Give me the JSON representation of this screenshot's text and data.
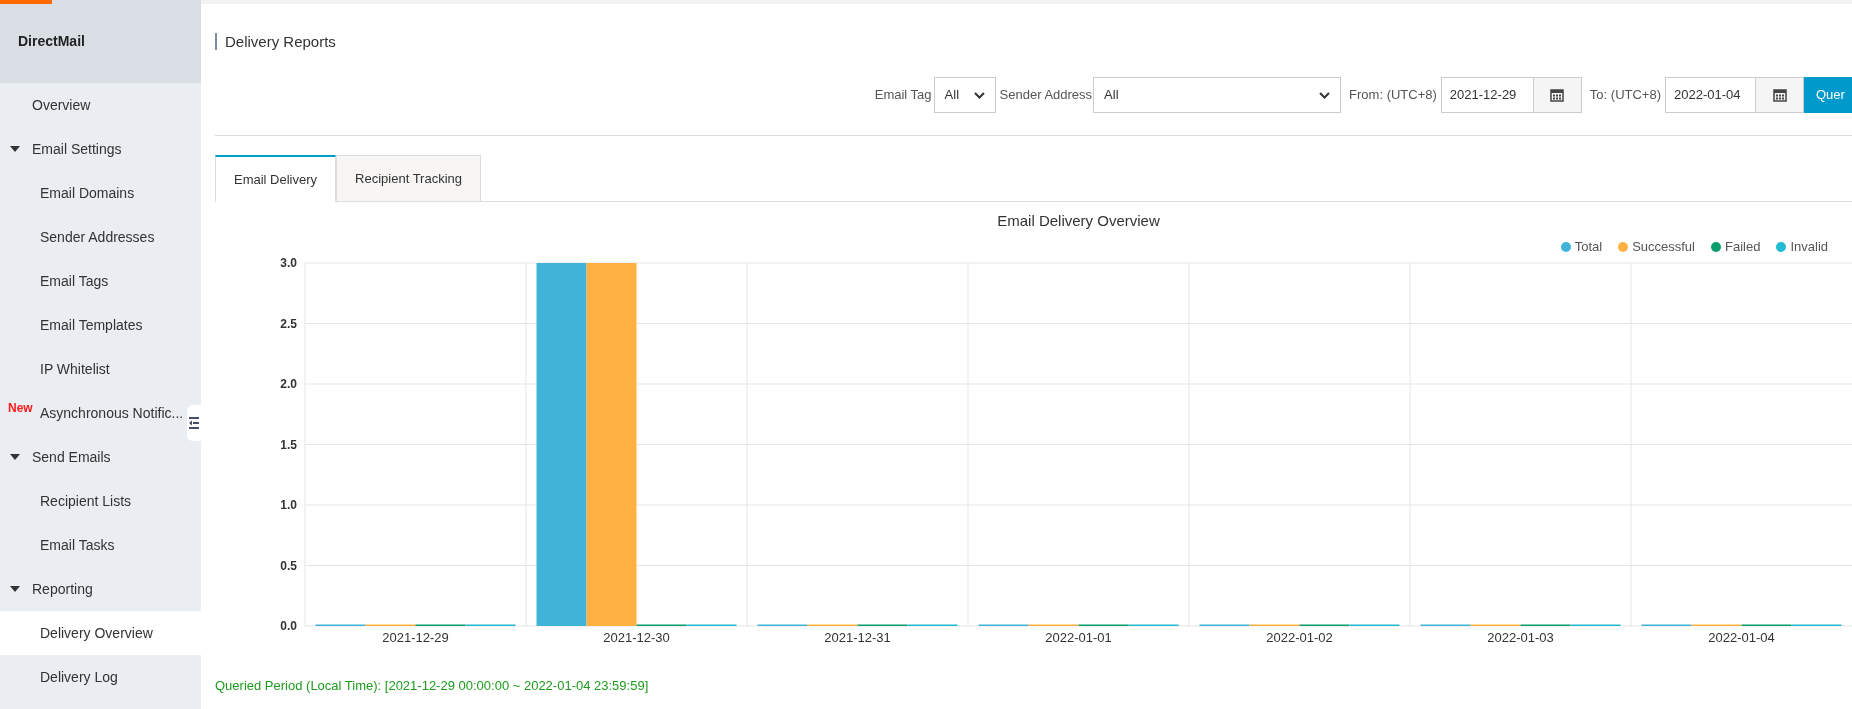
{
  "sidebar": {
    "title": "DirectMail",
    "items": [
      {
        "label": "Overview",
        "selected": false
      },
      {
        "label": "Email Settings",
        "expanded": true,
        "children": [
          {
            "label": "Email Domains",
            "selected": false
          },
          {
            "label": "Sender Addresses",
            "selected": false
          },
          {
            "label": "Email Tags",
            "selected": false
          },
          {
            "label": "Email Templates",
            "selected": false
          },
          {
            "label": "IP Whitelist",
            "selected": false
          },
          {
            "label": "Asynchronous Notific...",
            "badge": "New",
            "selected": false
          }
        ]
      },
      {
        "label": "Send Emails",
        "expanded": true,
        "children": [
          {
            "label": "Recipient Lists",
            "selected": false
          },
          {
            "label": "Email Tasks",
            "selected": false
          }
        ]
      },
      {
        "label": "Reporting",
        "expanded": true,
        "children": [
          {
            "label": "Delivery Overview",
            "selected": true
          },
          {
            "label": "Delivery Log",
            "selected": false
          }
        ]
      }
    ]
  },
  "page_title": "Delivery Reports",
  "filters": {
    "email_tag": {
      "label": "Email Tag",
      "value": "All"
    },
    "sender_address": {
      "label": "Sender Address",
      "value": "All"
    },
    "from": {
      "label": "From: (UTC+8)",
      "value": "2021-12-29"
    },
    "to": {
      "label": "To: (UTC+8)",
      "value": "2022-01-04"
    },
    "query_button": "Quer"
  },
  "tabs": [
    {
      "label": "Email Delivery",
      "selected": true
    },
    {
      "label": "Recipient Tracking",
      "selected": false
    }
  ],
  "chart": {
    "chart_data": {
      "type": "bar",
      "title": "Email Delivery Overview",
      "categories": [
        "2021-12-29",
        "2021-12-30",
        "2021-12-31",
        "2022-01-01",
        "2022-01-02",
        "2022-01-03",
        "2022-01-04"
      ],
      "series": [
        {
          "name": "Total",
          "color": "#41b3d9",
          "values": [
            0,
            3,
            0,
            0,
            0,
            0,
            0
          ]
        },
        {
          "name": "Successful",
          "color": "#ffb142",
          "values": [
            0,
            3,
            0,
            0,
            0,
            0,
            0
          ]
        },
        {
          "name": "Failed",
          "color": "#0a9d6a",
          "values": [
            0,
            0,
            0,
            0,
            0,
            0,
            0
          ]
        },
        {
          "name": "Invalid",
          "color": "#22bcd2",
          "values": [
            0,
            0,
            0,
            0,
            0,
            0,
            0
          ]
        }
      ],
      "grid": true,
      "ylim": [
        0,
        3
      ],
      "yticks": [
        {
          "value": 0,
          "label": "0.0"
        },
        {
          "value": 0.5,
          "label": "0.5"
        },
        {
          "value": 1,
          "label": "1.0"
        },
        {
          "value": 1.5,
          "label": "1.5"
        },
        {
          "value": 2,
          "label": "2.0"
        },
        {
          "value": 2.5,
          "label": "2.5"
        },
        {
          "value": 3,
          "label": "3.0"
        }
      ]
    }
  },
  "queried_period": "Queried Period (Local Time): [2021-12-29 00:00:00 ~ 2022-01-04 23:59:59]"
}
